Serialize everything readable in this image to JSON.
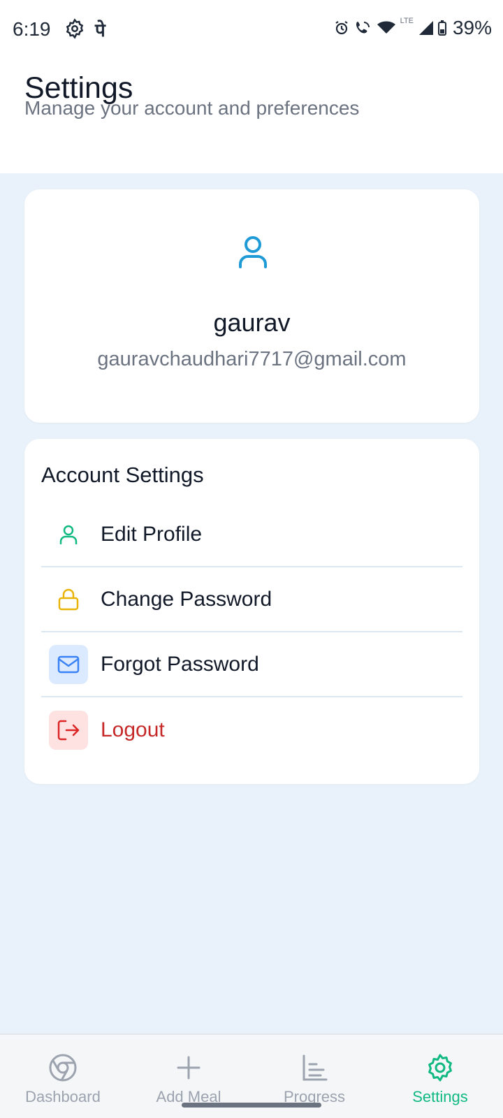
{
  "status": {
    "time": "6:19",
    "network_glyph": "पे",
    "lte": "LTE",
    "battery": "39%"
  },
  "header": {
    "title": "Settings",
    "subtitle": "Manage your account and preferences"
  },
  "profile": {
    "icon": "user-icon",
    "name": "gaurav",
    "email": "gauravchaudhari7717@gmail.com"
  },
  "account_settings": {
    "title": "Account Settings",
    "items": [
      {
        "label": "Edit Profile",
        "icon": "user-icon",
        "color": "#10b981"
      },
      {
        "label": "Change Password",
        "icon": "lock-icon",
        "color": "#eab308"
      },
      {
        "label": "Forgot Password",
        "icon": "mail-icon",
        "color": "#3b82f6"
      },
      {
        "label": "Logout",
        "icon": "logout-icon",
        "color": "#dc2626"
      }
    ]
  },
  "bottom_nav": {
    "items": [
      {
        "label": "Dashboard",
        "icon": "chrome-icon"
      },
      {
        "label": "Add Meal",
        "icon": "plus-icon"
      },
      {
        "label": "Progress",
        "icon": "bar-chart-icon"
      },
      {
        "label": "Settings",
        "icon": "gear-icon"
      }
    ],
    "active_index": 3
  },
  "colors": {
    "accent": "#10b981",
    "background": "#e9f2fa",
    "danger": "#c62828"
  }
}
